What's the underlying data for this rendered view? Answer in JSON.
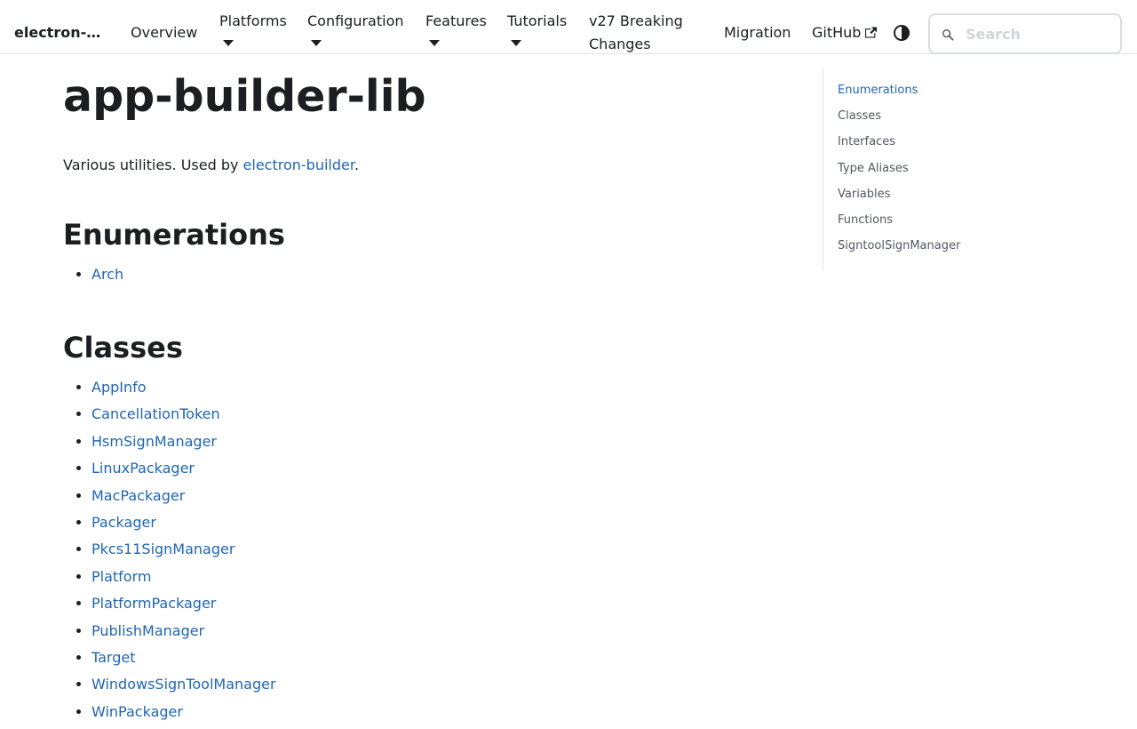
{
  "navbar": {
    "brand": "electron-…",
    "items": [
      {
        "label": "Overview"
      },
      {
        "label": "Platforms"
      },
      {
        "label": "Configuration"
      },
      {
        "label": "Features"
      },
      {
        "label": "Tutorials"
      },
      {
        "label_line1": "v27 Breaking",
        "label_line2": "Changes"
      },
      {
        "label": "Migration"
      },
      {
        "label": "GitHub"
      }
    ],
    "search_placeholder": "Search",
    "icons": [
      "external-link-icon",
      "theme-toggle-icon",
      "search-icon",
      "caret-down-icon"
    ]
  },
  "main": {
    "title": "app-builder-lib",
    "intro_text": "Various utilities. Used by ",
    "intro_link": "electron-builder",
    "intro_end": ".",
    "enumerations": {
      "heading": "Enumerations",
      "items": [
        "Arch"
      ]
    },
    "classes": {
      "heading": "Classes",
      "items": [
        "AppInfo",
        "CancellationToken",
        "HsmSignManager",
        "LinuxPackager",
        "MacPackager",
        "Packager",
        "Pkcs11SignManager",
        "Platform",
        "PlatformPackager",
        "PublishManager",
        "Target",
        "WindowsSignToolManager",
        "WinPackager"
      ]
    }
  },
  "toc": {
    "items": [
      "Enumerations",
      "Classes",
      "Interfaces",
      "Type Aliases",
      "Variables",
      "Functions",
      "SigntoolSignManager"
    ],
    "active_index": 0
  },
  "colors": {
    "link": "#1f66b3",
    "text": "#1c1e21",
    "toc_text": "#525860",
    "border": "#e3e3e3"
  }
}
